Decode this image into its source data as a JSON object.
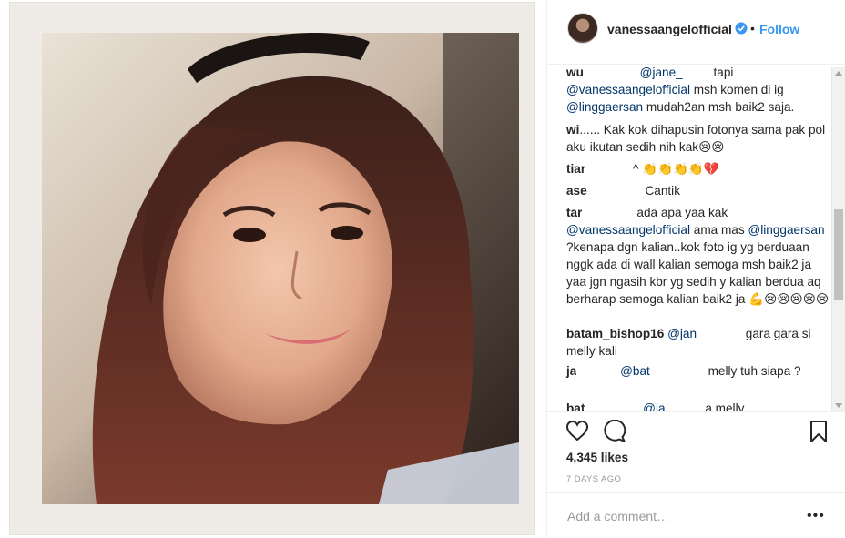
{
  "post": {
    "username": "vanessaangelofficial",
    "follow_label": "Follow",
    "separator": "•"
  },
  "comments": [
    {
      "user": "wu",
      "mention1": "@jane_",
      "text1": " tapi ",
      "mention2": "@vanessaangelofficial",
      "text2": " msh komen di ig ",
      "mention3": "@linggaersan",
      "text3": " mudah2an msh baik2 saja."
    },
    {
      "user": "wi",
      "text": "...... Kak kok dihapusin fotonya sama pak pol aku ikutan sedih nih kak😢😢"
    },
    {
      "user": "tiar",
      "text": "^ 👏👏👏👏💔"
    },
    {
      "user": "ase",
      "text": "Cantik"
    },
    {
      "user": "tar",
      "text1": "ada apa yaa kak ",
      "mention1": "@vanessaangelofficial",
      "text2": " ama mas ",
      "mention2": "@linggaersan",
      "text3": " ?kenapa dgn kalian..kok foto ig yg berduaan nggk ada di wall kalian semoga msh baik2 ja yaa jgn ngasih kbr yg sedih y kalian berdua aq berharap semoga kalian baik2 ja 💪😢😢😢😢😢"
    },
    {
      "user": "batam_bishop16",
      "mention1": "@jan",
      "text1": " gara gara si melly kali"
    },
    {
      "user": "ja",
      "mention1": "@bat",
      "text1": " melly tuh siapa ?"
    },
    {
      "user": "bat",
      "mention1": "@ja",
      "text1": " a melly"
    }
  ],
  "likes": "4,345 likes",
  "timestamp": "7 DAYS AGO",
  "add_comment": {
    "placeholder": "Add a comment…",
    "more_label": "•••"
  },
  "colors": {
    "link": "#3897f0",
    "mention": "#003569",
    "verified": "#3897f0",
    "muted": "#999999"
  },
  "icons": [
    "verified-badge-icon",
    "heart-icon",
    "comment-icon",
    "bookmark-icon",
    "more-options-icon"
  ]
}
